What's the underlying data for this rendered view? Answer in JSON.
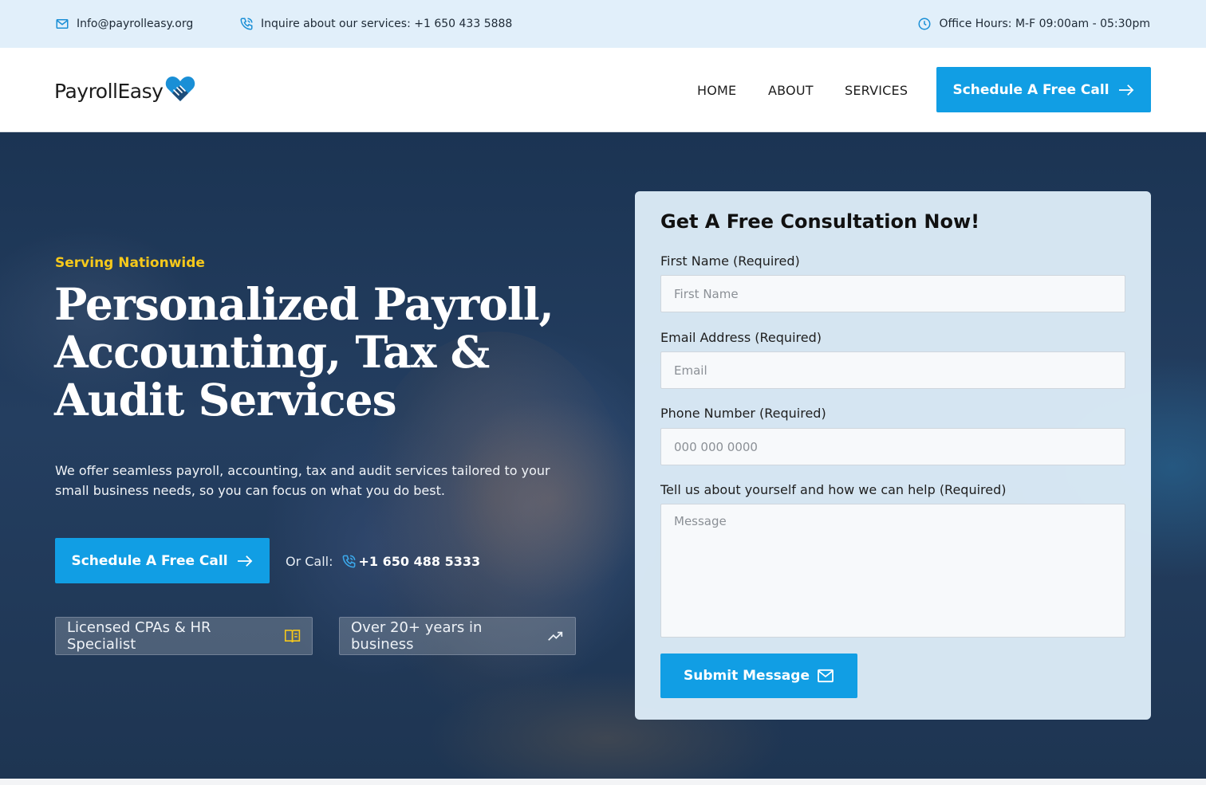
{
  "topbar": {
    "email": "Info@payrolleasy.org",
    "phone": "Inquire about our services: +1 650 433 5888",
    "hours": "Office Hours: M-F 09:00am - 05:30pm"
  },
  "header": {
    "logo_text": "PayrollEasy",
    "nav": [
      "HOME",
      "ABOUT",
      "SERVICES"
    ],
    "cta_label": "Schedule A Free Call"
  },
  "hero": {
    "tagline": "Serving Nationwide",
    "headline": "Personalized Payroll, Accounting, Tax & Audit Services",
    "subtext": "We offer seamless payroll, accounting, tax and audit services tailored to your small business needs, so you can focus on what you do best.",
    "cta_label": "Schedule A Free Call",
    "or_call_label": "Or Call:",
    "or_call_number": "+1 650 488 5333",
    "badges": [
      "Licensed CPAs & HR Specialist",
      "Over 20+ years in business"
    ]
  },
  "form": {
    "title": "Get A Free Consultation Now!",
    "first_name_label": "First Name (Required)",
    "first_name_placeholder": "First Name",
    "email_label": "Email Address (Required)",
    "email_placeholder": "Email",
    "phone_label": "Phone Number (Required)",
    "phone_placeholder": "000 000 0000",
    "message_label": "Tell us about yourself and how we can help (Required)",
    "message_placeholder": "Message",
    "submit_label": "Submit Message"
  },
  "colors": {
    "accent": "#119ee4",
    "tagline": "#f6c81b",
    "topbar_bg": "#e1effa",
    "card_bg": "#ddecf8"
  }
}
